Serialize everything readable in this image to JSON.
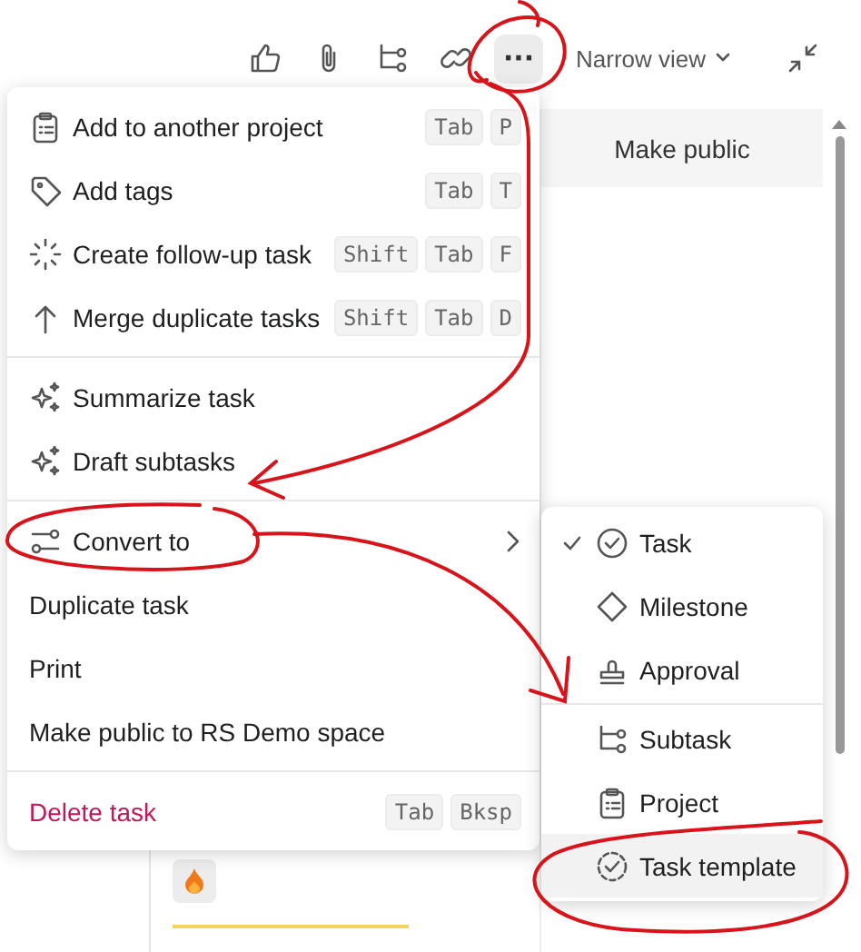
{
  "toolbar": {
    "buttons": [
      {
        "kind": "thumb"
      },
      {
        "kind": "clip"
      },
      {
        "kind": "subtask"
      },
      {
        "kind": "link"
      },
      {
        "kind": "more",
        "label": "···",
        "selected": true
      }
    ],
    "view": {
      "label": "Narrow view"
    }
  },
  "panel": {
    "header": "Make public"
  },
  "menu": {
    "sections": [
      [
        {
          "kind": "project",
          "label": "Add to another project",
          "keys": [
            "Tab",
            "P"
          ]
        },
        {
          "kind": "tag",
          "label": "Add tags",
          "keys": [
            "Tab",
            "T"
          ]
        },
        {
          "kind": "spark",
          "label": "Create follow-up task",
          "keys": [
            "Shift",
            "Tab",
            "F"
          ]
        },
        {
          "kind": "merge",
          "label": "Merge duplicate tasks",
          "keys": [
            "Shift",
            "Tab",
            "D"
          ]
        }
      ],
      [
        {
          "kind": "ai",
          "label": "Summarize task"
        },
        {
          "kind": "ai",
          "label": "Draft subtasks"
        }
      ],
      [
        {
          "kind": "convert",
          "label": "Convert to",
          "submenu": true
        },
        {
          "kind": "none",
          "label": "Duplicate task"
        },
        {
          "kind": "none",
          "label": "Print"
        },
        {
          "kind": "none",
          "label": "Make public to RS Demo space"
        }
      ],
      [
        {
          "kind": "none",
          "label": "Delete task",
          "danger": true,
          "keys": [
            "Tab",
            "Bksp"
          ]
        }
      ]
    ]
  },
  "submenu": {
    "sections": [
      [
        {
          "kind": "task",
          "label": "Task",
          "checked": true,
          "highlighted": false
        },
        {
          "kind": "milestone",
          "label": "Milestone",
          "checked": false,
          "highlighted": false
        },
        {
          "kind": "approval",
          "label": "Approval",
          "checked": false,
          "highlighted": false
        }
      ],
      [
        {
          "kind": "subtask",
          "label": "Subtask",
          "checked": false,
          "highlighted": false
        },
        {
          "kind": "project",
          "label": "Project",
          "checked": false,
          "highlighted": false
        },
        {
          "kind": "template",
          "label": "Task template",
          "checked": false,
          "highlighted": true
        }
      ]
    ]
  }
}
